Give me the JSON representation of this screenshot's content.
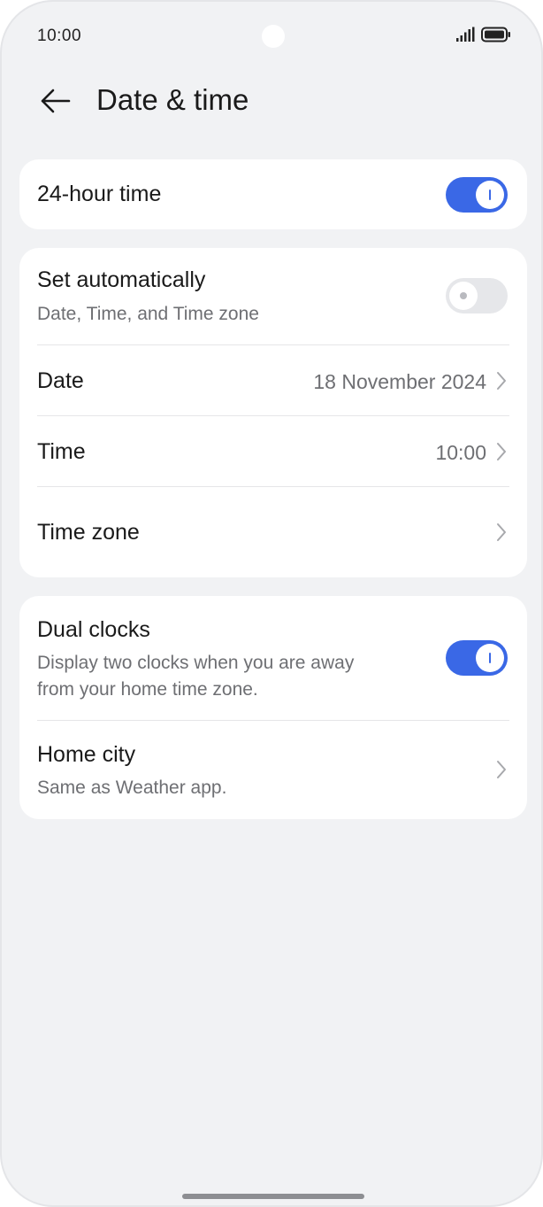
{
  "status_bar": {
    "time": "10:00"
  },
  "header": {
    "title": "Date & time"
  },
  "hour24": {
    "label": "24-hour time",
    "enabled": true
  },
  "auto": {
    "label": "Set automatically",
    "sublabel": "Date, Time, and Time zone",
    "enabled": false
  },
  "date": {
    "label": "Date",
    "value": "18 November 2024"
  },
  "time": {
    "label": "Time",
    "value": "10:00"
  },
  "timezone": {
    "label": "Time zone"
  },
  "dual_clocks": {
    "label": "Dual clocks",
    "sublabel_line1": "Display two clocks when you are away",
    "sublabel_line2": "from your home time zone.",
    "enabled": true
  },
  "home_city": {
    "label": "Home city",
    "sublabel": "Same as Weather app."
  },
  "colors": {
    "accent": "#3a68e6",
    "background": "#f1f2f4",
    "card": "#ffffff",
    "secondary_text": "#6e6f73"
  },
  "icons": [
    "back-arrow-icon",
    "chevron-right-icon",
    "signal-icon",
    "battery-icon"
  ]
}
